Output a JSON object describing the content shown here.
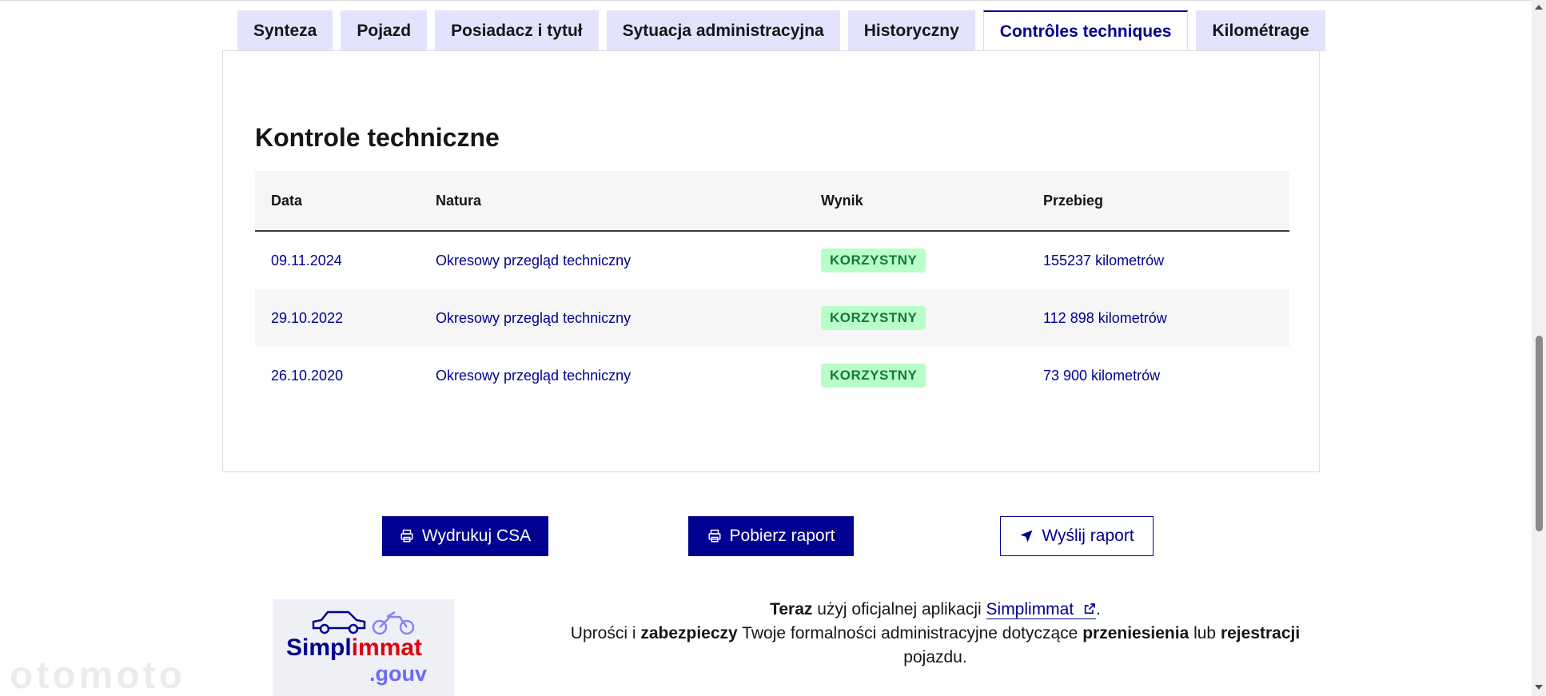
{
  "tabs": [
    {
      "label": "Synteza"
    },
    {
      "label": "Pojazd"
    },
    {
      "label": "Posiadacz i tytuł"
    },
    {
      "label": "Sytuacja administracyjna"
    },
    {
      "label": "Historyczny"
    },
    {
      "label": "Contrôles techniques",
      "active": true
    },
    {
      "label": "Kilométrage"
    }
  ],
  "panel": {
    "title": "Kontrole techniczne",
    "columns": [
      "Data",
      "Natura",
      "Wynik",
      "Przebieg"
    ],
    "rows": [
      {
        "date": "09.11.2024",
        "nature": "Okresowy przegląd techniczny",
        "result": "KORZYSTNY",
        "mileage": "155237 kilometrów"
      },
      {
        "date": "29.10.2022",
        "nature": "Okresowy przegląd techniczny",
        "result": "KORZYSTNY",
        "mileage": "112 898 kilometrów"
      },
      {
        "date": "26.10.2020",
        "nature": "Okresowy przegląd techniczny",
        "result": "KORZYSTNY",
        "mileage": "73 900 kilometrów"
      }
    ]
  },
  "actions": {
    "print_label": "Wydrukuj CSA",
    "download_label": "Pobierz raport",
    "send_label": "Wyślij raport"
  },
  "promo": {
    "logo_main_a": "Simpl",
    "logo_main_b": "immat",
    "logo_sub": ".gouv",
    "line1_bold": "Teraz",
    "line1_text": " użyj oficjalnej aplikacji ",
    "line1_link": "Simplimmat",
    "line1_end": ".",
    "line2_a": "Uprości i ",
    "line2_b": "zabezpieczy",
    "line2_c": " Twoje formalności administracyjne dotyczące ",
    "line2_d": "przeniesienia",
    "line2_e": " lub ",
    "line2_f": "rejestracji",
    "line3": "pojazdu."
  },
  "watermark": "otomoto",
  "colors": {
    "primary": "#000091",
    "tab_bg": "#e3e3fd",
    "success_bg": "#b8fec9",
    "success_text": "#18753c"
  }
}
